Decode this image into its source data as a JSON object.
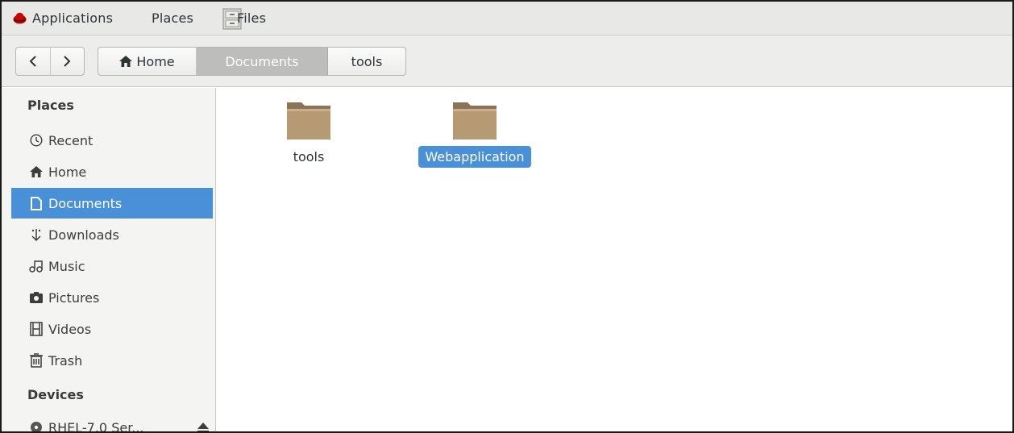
{
  "topbar": {
    "applications": "Applications",
    "places": "Places",
    "files": "Files"
  },
  "toolbar": {
    "back_icon": "chevron-left-icon",
    "forward_icon": "chevron-right-icon",
    "breadcrumbs": [
      "Home",
      "Documents",
      "tools"
    ],
    "active_crumb": "Documents"
  },
  "sidebar": {
    "places_header": "Places",
    "items": [
      {
        "label": "Recent",
        "icon": "clock-icon"
      },
      {
        "label": "Home",
        "icon": "home-icon"
      },
      {
        "label": "Documents",
        "icon": "document-icon",
        "selected": true
      },
      {
        "label": "Downloads",
        "icon": "download-icon"
      },
      {
        "label": "Music",
        "icon": "music-icon"
      },
      {
        "label": "Pictures",
        "icon": "camera-icon"
      },
      {
        "label": "Videos",
        "icon": "film-icon"
      },
      {
        "label": "Trash",
        "icon": "trash-icon"
      }
    ],
    "devices_header": "Devices",
    "devices": [
      {
        "label": "RHEL-7.0 Ser...",
        "icon": "disc-icon",
        "action_icon": "eject-icon"
      }
    ]
  },
  "main": {
    "files": [
      {
        "name": "tools",
        "icon": "folder-icon",
        "selected": false
      },
      {
        "name": "Webapplication",
        "icon": "folder-icon",
        "selected": true
      }
    ]
  },
  "colors": {
    "selection": "#4a90d9",
    "folder": "#b69a73"
  }
}
